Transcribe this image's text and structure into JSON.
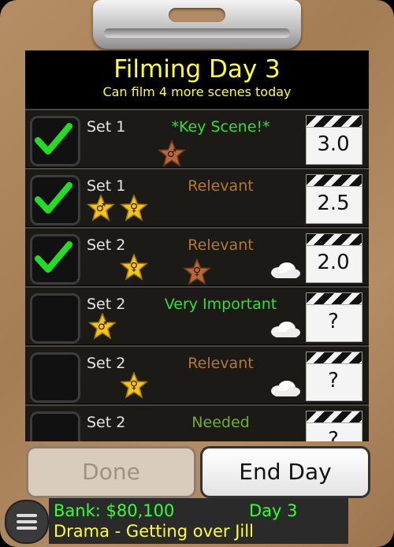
{
  "header": {
    "title": "Filming Day 3",
    "subtitle": "Can film 4 more scenes today"
  },
  "scenes": [
    {
      "set": "Set 1",
      "importance": "*Key Scene!*",
      "importance_color": "#33dd33",
      "checked": true,
      "score": "3.0",
      "stars": [
        "bronze-male"
      ],
      "cloud": false
    },
    {
      "set": "Set 1",
      "importance": "Relevant",
      "importance_color": "#b07a2a",
      "checked": true,
      "score": "2.5",
      "stars": [
        "gold-male",
        "gold-female"
      ],
      "cloud": false
    },
    {
      "set": "Set 2",
      "importance": "Relevant",
      "importance_color": "#b07a2a",
      "checked": true,
      "score": "2.0",
      "stars": [
        "gold-female",
        "bronze-female"
      ],
      "cloud": true
    },
    {
      "set": "Set 2",
      "importance": "Very Important",
      "importance_color": "#33dd33",
      "checked": false,
      "score": "?",
      "stars": [
        "gold-male"
      ],
      "cloud": true
    },
    {
      "set": "Set 2",
      "importance": "Relevant",
      "importance_color": "#b07a2a",
      "checked": false,
      "score": "?",
      "stars": [
        "gold-female"
      ],
      "cloud": true
    },
    {
      "set": "Set 2",
      "importance": "Needed",
      "importance_color": "#6fae2f",
      "checked": false,
      "score": "?",
      "stars": [],
      "cloud": false
    }
  ],
  "buttons": {
    "done_label": "Done",
    "end_day_label": "End Day"
  },
  "status": {
    "bank": "Bank: $80,100",
    "day": "Day 3",
    "project": "Drama - Getting over Jill"
  },
  "icons": {
    "menu": "hamburger-menu-icon",
    "check": "checkmark-icon",
    "star": "star-icon",
    "cloud": "cloud-icon",
    "clapper": "clapperboard-icon"
  }
}
